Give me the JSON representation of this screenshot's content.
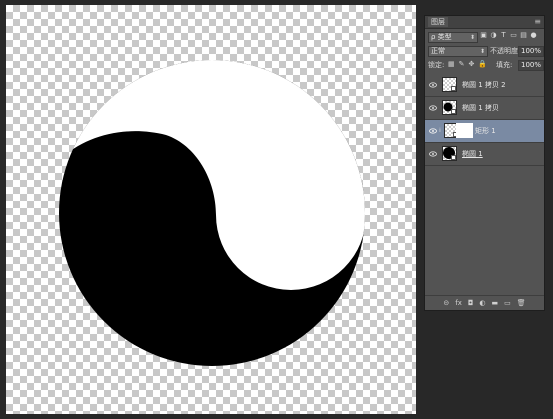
{
  "panel": {
    "tab_label": "图层",
    "menu_icon": "panel-menu-icon",
    "filter_kind": "ρ 类型",
    "blend_mode": "正常",
    "opacity_label": "不透明度:",
    "opacity_value": "100%",
    "lock_label": "锁定:",
    "fill_label": "填充:",
    "fill_value": "100%"
  },
  "layers": [
    {
      "name": "椭圆 1 拷贝 2",
      "visible": true,
      "selected": false
    },
    {
      "name": "椭圆 1 拷贝",
      "visible": true,
      "selected": false
    },
    {
      "name": "矩形 1",
      "visible": true,
      "selected": true
    },
    {
      "name": "椭圆 1",
      "visible": true,
      "selected": false
    }
  ],
  "footer_icons": [
    "link-layers-icon",
    "fx-icon",
    "add-mask-icon",
    "adjustment-layer-icon",
    "group-folder-icon",
    "new-layer-icon",
    "trash-icon"
  ],
  "footer_glyphs": [
    "⊝",
    "fx",
    "◘",
    "◐",
    "▬",
    "▭",
    "🗑"
  ],
  "colors": {
    "selected_layer": "#7a8aa3",
    "panel_bg": "#535353",
    "app_bg": "#282828"
  }
}
